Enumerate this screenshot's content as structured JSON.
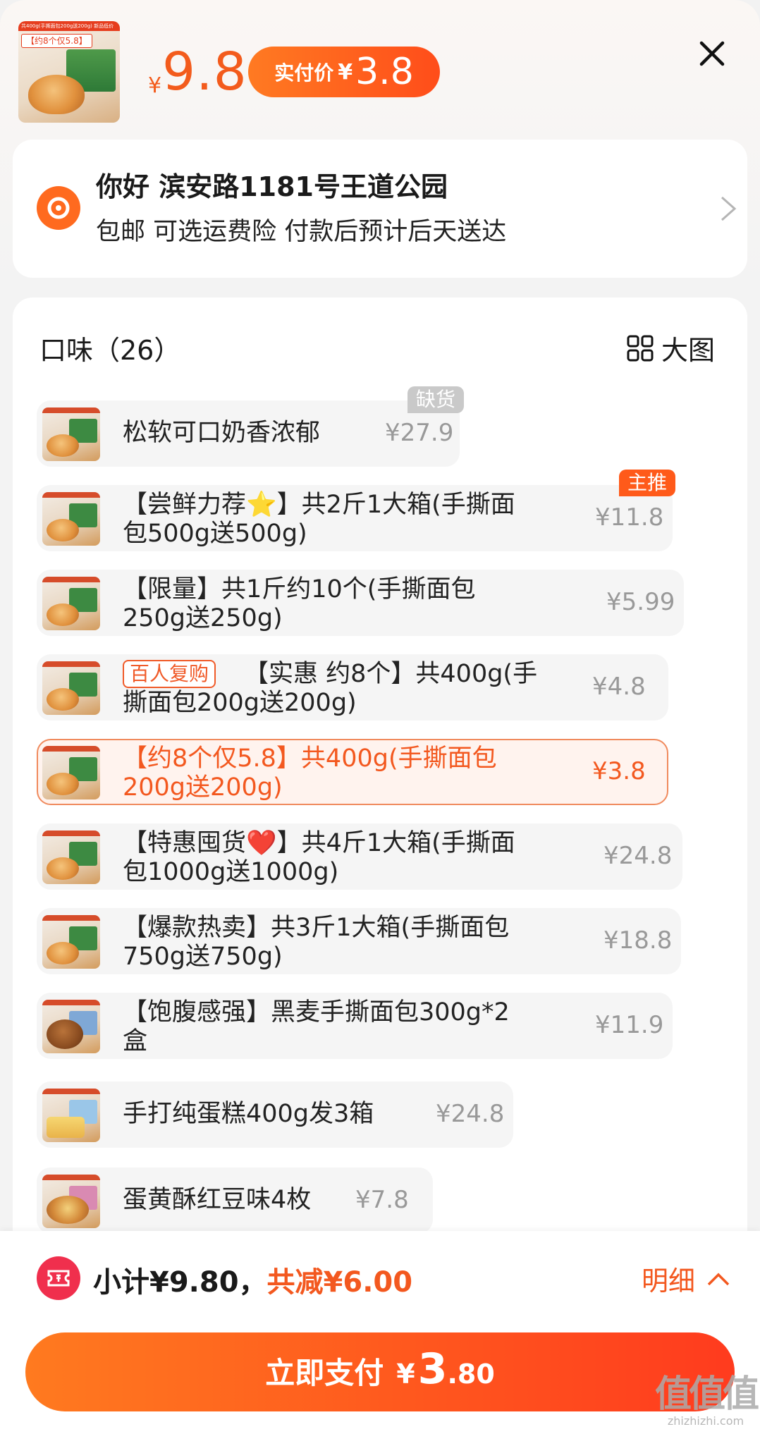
{
  "header": {
    "thumb_banner": "共400g(手撕面包200g送200g) 新品低价",
    "thumb_tag": "【约8个仅5.8】",
    "price_symbol": "¥",
    "price": "9.8",
    "pay_label": "实付价",
    "pay_symbol": "¥",
    "pay_price": "3.8"
  },
  "address": {
    "title": "你好 滨安路1181号王道公园",
    "subtitle": "包邮 可选运费险 付款后预计后天送达"
  },
  "options": {
    "title": "口味（26）",
    "big_view_label": "大图",
    "items": [
      {
        "label": "松软可口奶香浓郁",
        "price": "¥27.9",
        "tag": "缺货"
      },
      {
        "label_line1": "【尝鲜力荐⭐】共2斤1大箱(手撕面",
        "label_line2": "包500g送500g)",
        "price": "¥11.8",
        "tag": "主推"
      },
      {
        "label_line1": "【限量】共1斤约10个(手撕面包",
        "label_line2": "250g送250g)",
        "price": "¥5.99"
      },
      {
        "badge": "百人复购",
        "label_line1": "【实惠 约8个】共400g(手",
        "label_line2": "撕面包200g送200g)",
        "price": "¥4.8"
      },
      {
        "label_line1": "【约8个仅5.8】共400g(手撕面包",
        "label_line2": "200g送200g)",
        "price": "¥3.8"
      },
      {
        "label_line1": "【特惠囤货❤️】共4斤1大箱(手撕面",
        "label_line2": "包1000g送1000g)",
        "price": "¥24.8"
      },
      {
        "label_line1": "【爆款热卖】共3斤1大箱(手撕面包",
        "label_line2": "750g送750g)",
        "price": "¥18.8"
      },
      {
        "label_line1": "【饱腹感强】黑麦手撕面包300g*2",
        "label_line2": "盒",
        "price": "¥11.9"
      },
      {
        "label": "手打纯蛋糕400g发3箱",
        "price": "¥24.8"
      },
      {
        "label": "蛋黄酥红豆味4枚",
        "price": "¥7.8"
      }
    ]
  },
  "footer": {
    "subtotal": "小计¥9.80，",
    "discount": "共减¥6.00",
    "detail": "明细",
    "pay_label": "立即支付",
    "pay_symbol": "¥",
    "pay_int": "3",
    "pay_dec": ".80"
  },
  "watermark": {
    "main": "值值值",
    "sub": "zhizhizhi.com"
  },
  "colors": {
    "accent": "#ff5a1a",
    "price": "#f35b1c",
    "coupon": "#f02f4d"
  }
}
